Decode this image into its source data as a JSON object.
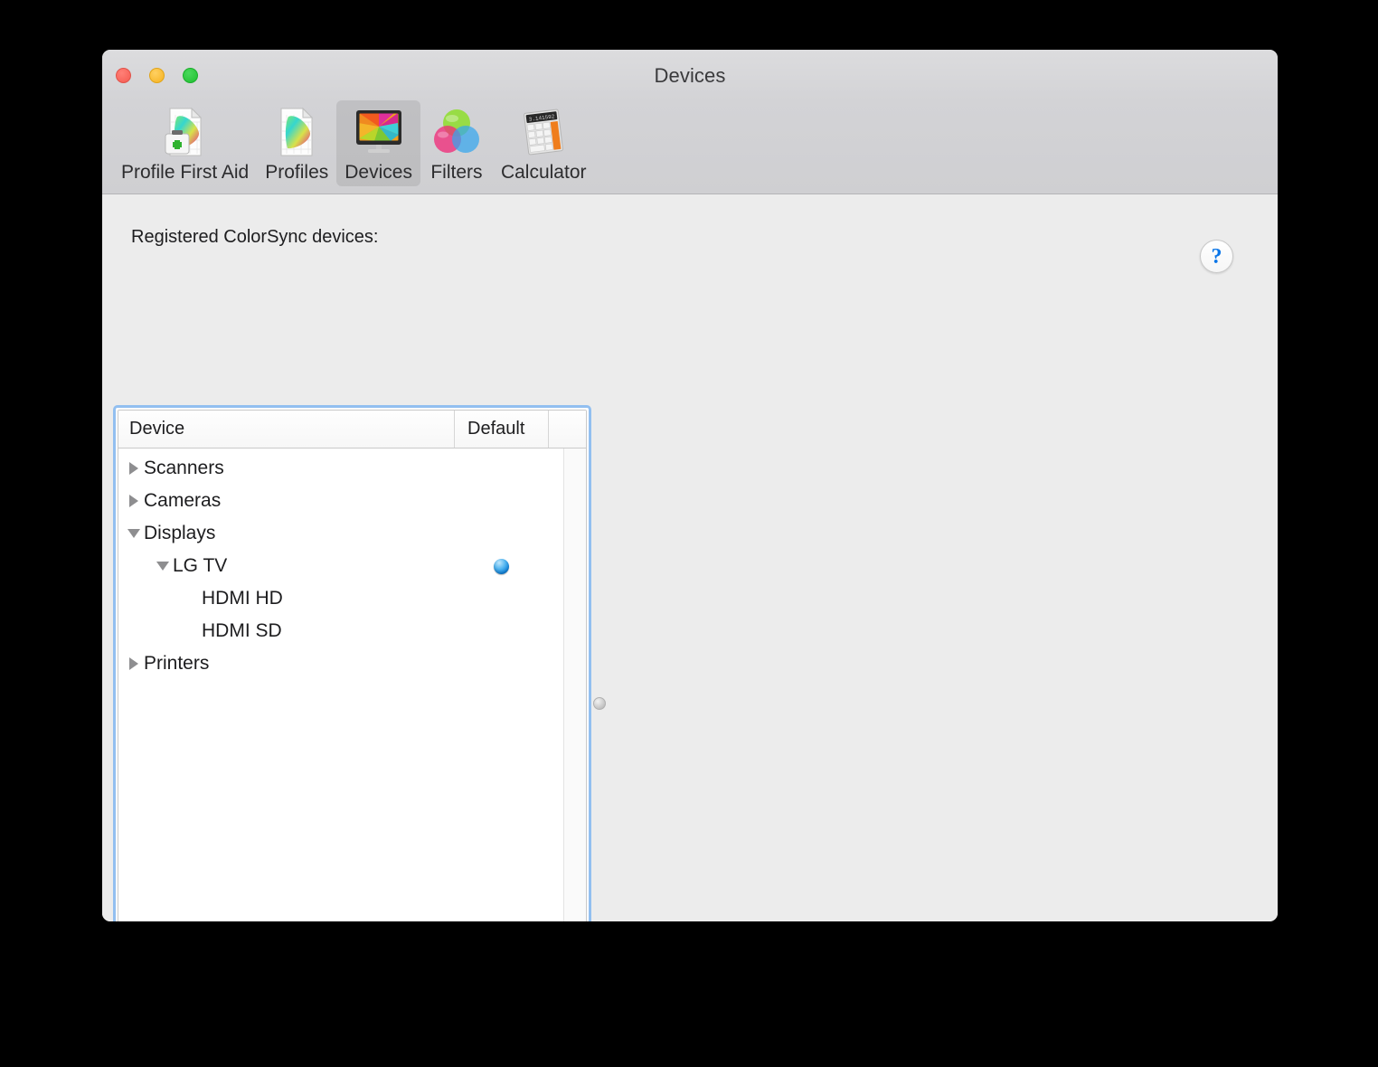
{
  "window": {
    "title": "Devices",
    "traffic_lights": [
      {
        "name": "close",
        "color": "#f45a50"
      },
      {
        "name": "minimize",
        "color": "#f5b21f"
      },
      {
        "name": "zoom",
        "color": "#1fbe30"
      }
    ]
  },
  "toolbar": {
    "items": [
      {
        "id": "profile-first-aid",
        "label": "Profile First Aid",
        "icon": "profile-first-aid-icon",
        "selected": false
      },
      {
        "id": "profiles",
        "label": "Profiles",
        "icon": "profiles-icon",
        "selected": false
      },
      {
        "id": "devices",
        "label": "Devices",
        "icon": "devices-icon",
        "selected": true
      },
      {
        "id": "filters",
        "label": "Filters",
        "icon": "filters-icon",
        "selected": false
      },
      {
        "id": "calculator",
        "label": "Calculator",
        "icon": "calculator-icon",
        "selected": false
      }
    ]
  },
  "main": {
    "section_label": "Registered ColorSync devices:",
    "help_button": {
      "glyph": "?",
      "name": "help-icon",
      "color": "#0b76e8"
    },
    "tree": {
      "columns": [
        {
          "id": "device",
          "label": "Device"
        },
        {
          "id": "default",
          "label": "Default"
        },
        {
          "id": "extra",
          "label": ""
        }
      ],
      "rows": [
        {
          "label": "Scanners",
          "level": 0,
          "twisty": "collapsed",
          "is_default": false
        },
        {
          "label": "Cameras",
          "level": 0,
          "twisty": "collapsed",
          "is_default": false
        },
        {
          "label": "Displays",
          "level": 0,
          "twisty": "expanded",
          "is_default": false
        },
        {
          "label": "LG TV",
          "level": 1,
          "twisty": "expanded",
          "is_default": true
        },
        {
          "label": "HDMI HD",
          "level": 2,
          "twisty": "none",
          "is_default": false
        },
        {
          "label": "HDMI SD",
          "level": 2,
          "twisty": "none",
          "is_default": false
        },
        {
          "label": "Printers",
          "level": 0,
          "twisty": "collapsed",
          "is_default": false
        }
      ]
    }
  }
}
